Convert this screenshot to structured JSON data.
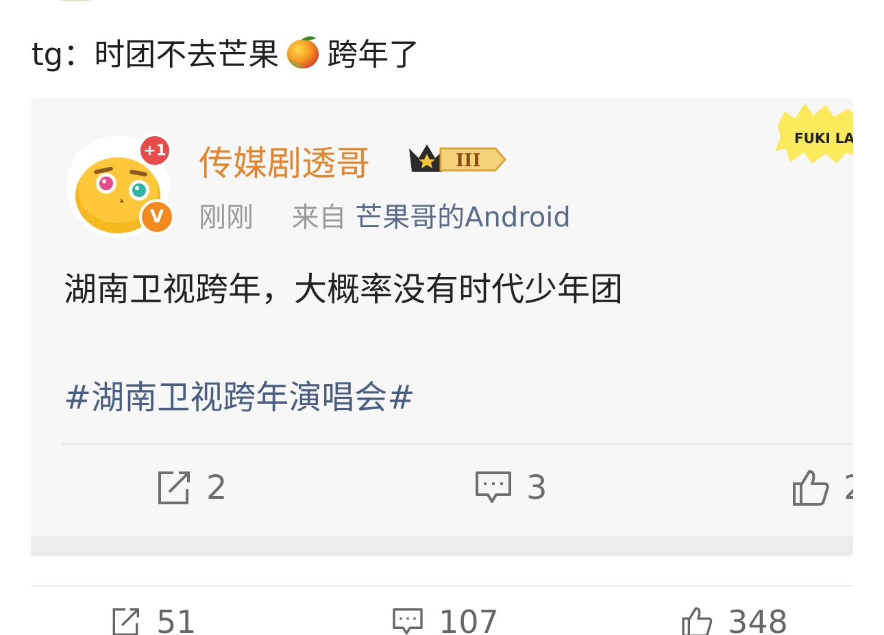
{
  "post": {
    "text_before": "tg：时团不去芒果",
    "text_after": "跨年了",
    "emoji_icon": "mango-icon"
  },
  "quoted": {
    "username": "传媒剧透哥",
    "level": "III",
    "badge_plus": "+1",
    "verified": "V",
    "time": "刚刚",
    "source_prefix": "来自",
    "source_device": "芒果哥的Android",
    "body": "湖南卫视跨年，大概率没有时代少年团",
    "hashtag": "#湖南卫视跨年演唱会#",
    "sticker_text": "FUKI LA",
    "actions": {
      "repost": "2",
      "comment": "3",
      "like": "2"
    }
  },
  "footer": {
    "repost": "51",
    "comment": "107",
    "like": "348"
  },
  "colors": {
    "username": "#e3852c",
    "hashtag": "#4a5d82",
    "device": "#5a6a8a",
    "meta": "#9a9a9a",
    "badge_plus": "#e94b4b",
    "badge_v": "#f28a1e"
  }
}
